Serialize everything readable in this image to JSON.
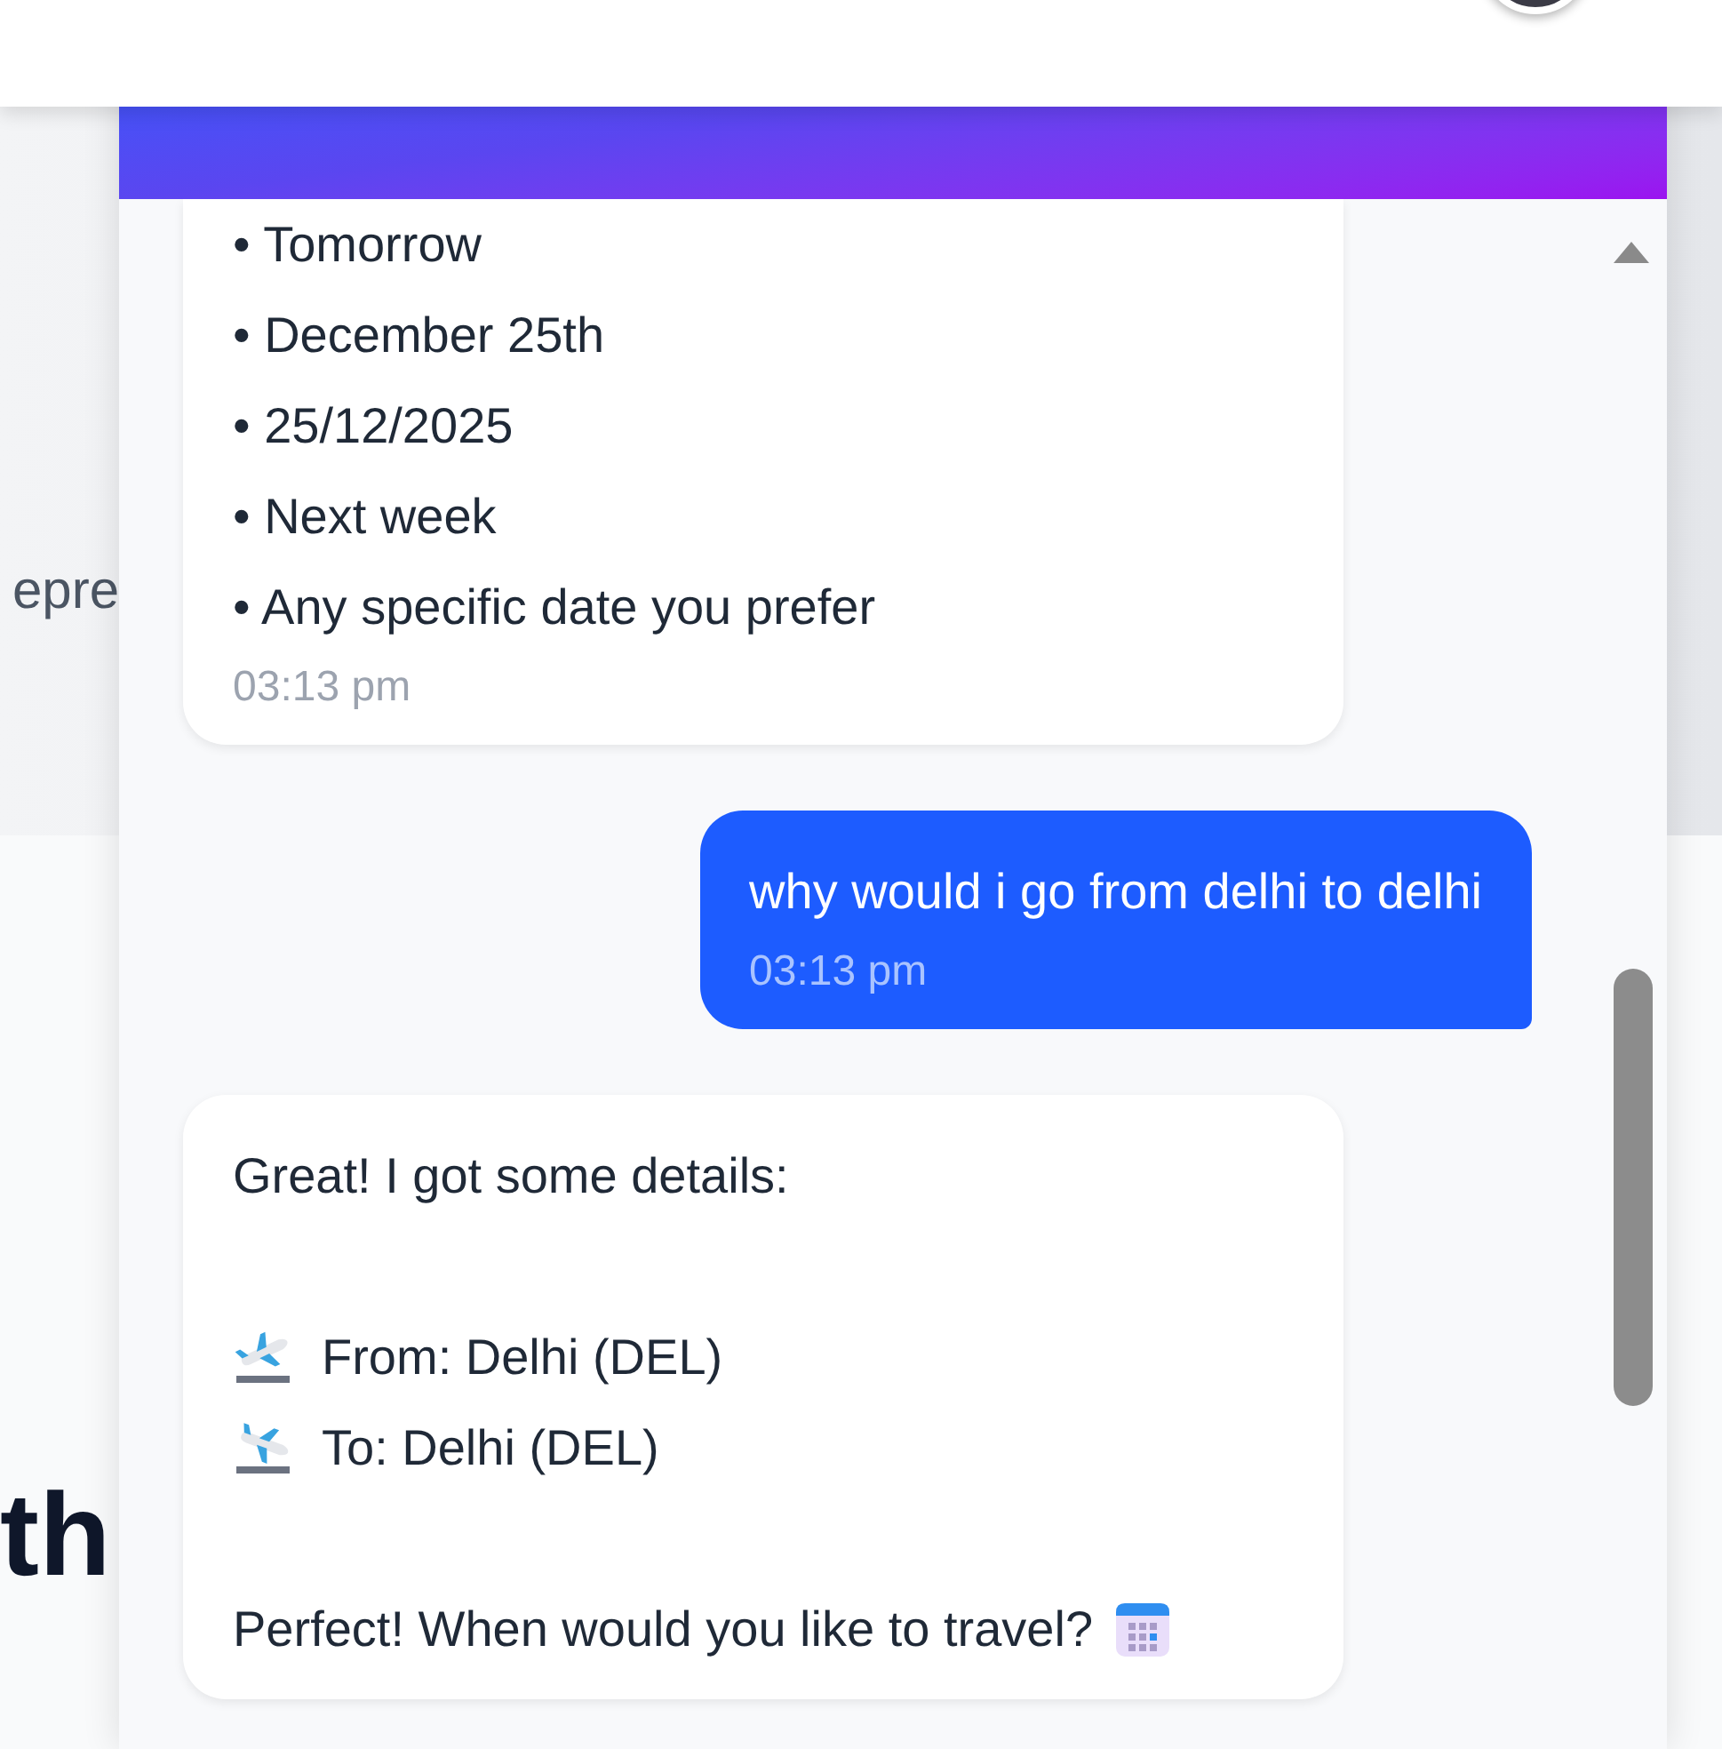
{
  "page": {
    "side_text": "epre",
    "heading_fragment": "th"
  },
  "chat": {
    "messages": [
      {
        "kind": "bot",
        "cut_top": true,
        "time": "03:13 pm",
        "blocks": [
          [
            {
              "kind": "plain",
              "text": "• Tomorrow"
            },
            {
              "kind": "plain",
              "text": "• December 25th"
            },
            {
              "kind": "plain",
              "text": "• 25/12/2025"
            },
            {
              "kind": "plain",
              "text": "• Next week"
            },
            {
              "kind": "plain",
              "text": "• Any specific date you prefer"
            }
          ]
        ]
      },
      {
        "kind": "user",
        "cut_top": false,
        "time": "03:13 pm",
        "blocks": [
          [
            {
              "kind": "plain",
              "text": "why would i go from delhi to delhi"
            }
          ]
        ]
      },
      {
        "kind": "bot",
        "cut_top": false,
        "blocks": [
          [
            {
              "kind": "plain",
              "text": "Great! I got some details:"
            }
          ],
          [
            {
              "kind": "departure",
              "text": "From: Delhi (DEL)"
            },
            {
              "kind": "arrival",
              "text": "To: Delhi (DEL)"
            }
          ],
          [
            {
              "kind": "calendar",
              "text": "Perfect! When would you like to travel?"
            }
          ]
        ]
      }
    ]
  }
}
